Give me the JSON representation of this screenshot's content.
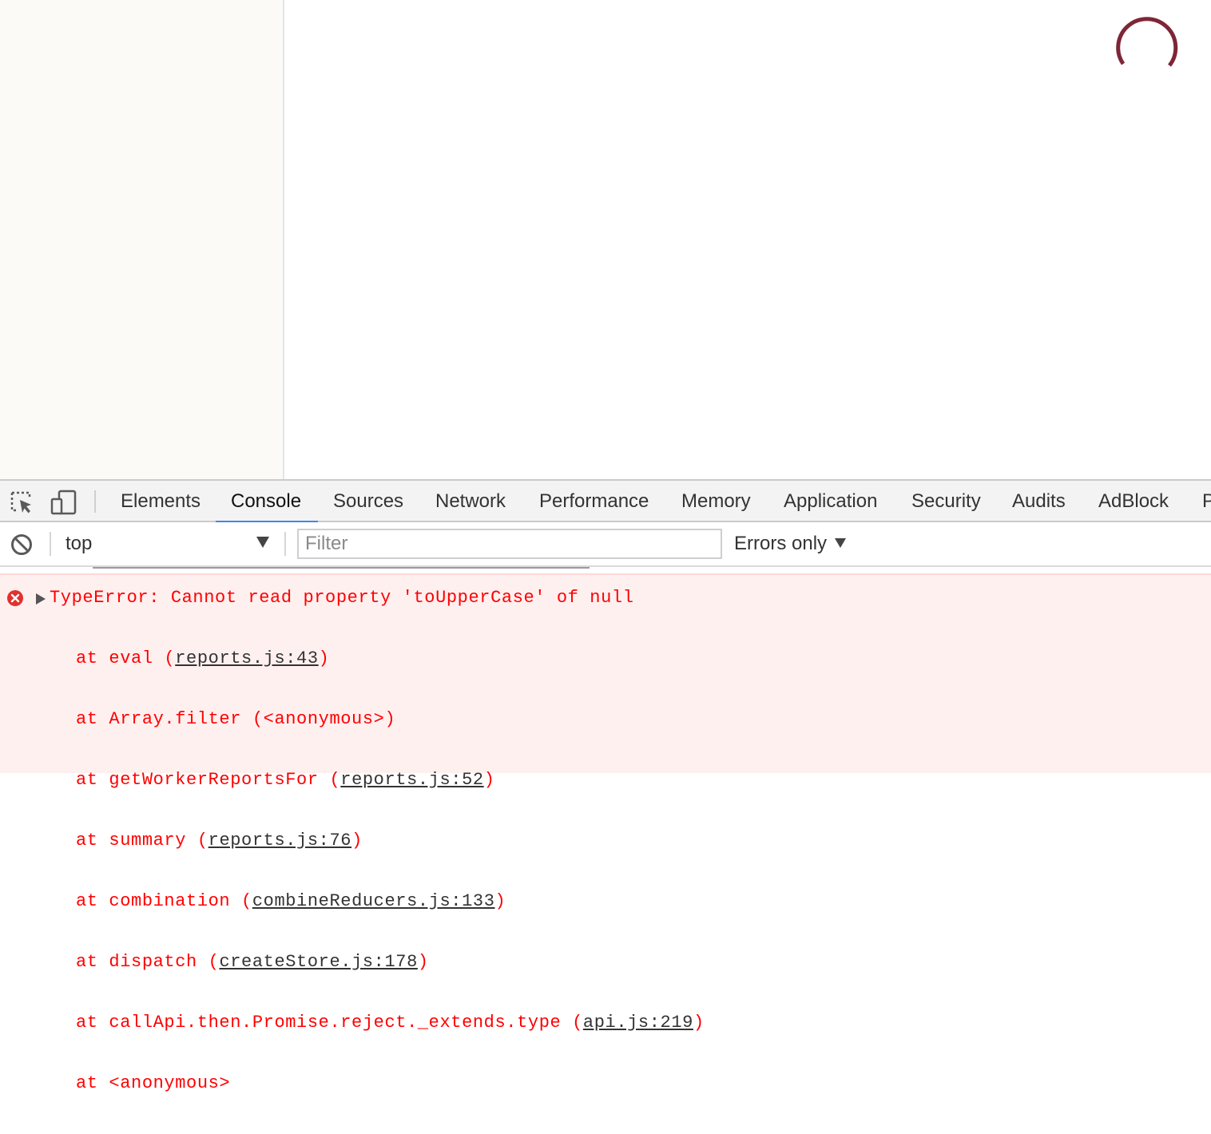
{
  "devtools": {
    "tabs": [
      {
        "label": "Elements"
      },
      {
        "label": "Console",
        "active": true
      },
      {
        "label": "Sources"
      },
      {
        "label": "Network"
      },
      {
        "label": "Performance"
      },
      {
        "label": "Memory"
      },
      {
        "label": "Application"
      },
      {
        "label": "Security"
      },
      {
        "label": "Audits"
      },
      {
        "label": "AdBlock"
      },
      {
        "label": "P"
      }
    ],
    "accent_color": "#4285f4"
  },
  "toolbar": {
    "context": "top",
    "filter_placeholder": "Filter",
    "levels": "Errors only"
  },
  "console": {
    "error": {
      "message": "TypeError: Cannot read property 'toUpperCase' of null",
      "color": "#ff0000",
      "stack": [
        {
          "prefix": "at eval (",
          "link": "reports.js:43",
          "suffix": ")"
        },
        {
          "prefix": "at Array.filter (<anonymous>)",
          "link": "",
          "suffix": ""
        },
        {
          "prefix": "at getWorkerReportsFor (",
          "link": "reports.js:52",
          "suffix": ")"
        },
        {
          "prefix": "at summary (",
          "link": "reports.js:76",
          "suffix": ")"
        },
        {
          "prefix": "at combination (",
          "link": "combineReducers.js:133",
          "suffix": ")"
        },
        {
          "prefix": "at dispatch (",
          "link": "createStore.js:178",
          "suffix": ")"
        },
        {
          "prefix": "at callApi.then.Promise.reject._extends.type (",
          "link": "api.js:219",
          "suffix": ")"
        },
        {
          "prefix": "at <anonymous>",
          "link": "",
          "suffix": ""
        }
      ]
    }
  },
  "page": {
    "spinner_color": "#7d2637"
  }
}
